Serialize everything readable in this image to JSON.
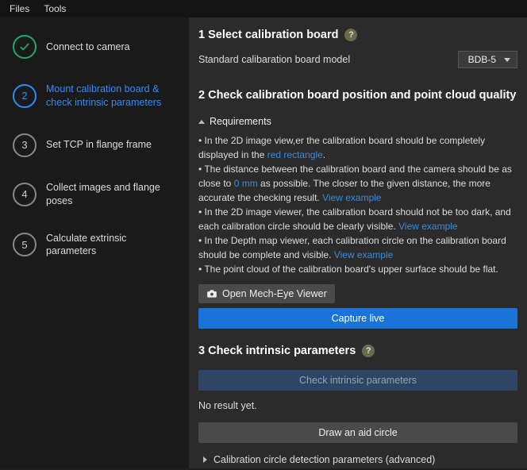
{
  "menu": {
    "files": "Files",
    "tools": "Tools"
  },
  "steps": {
    "s1": "Connect to camera",
    "s2": "Mount calibration board & check intrinsic parameters",
    "s3": "Set TCP in flange frame",
    "s4": "Collect images and flange poses",
    "s5": "Calculate extrinsic parameters",
    "n2": "2",
    "n3": "3",
    "n4": "4",
    "n5": "5"
  },
  "sec1": {
    "title": "1 Select calibration board",
    "label": "Standard calibaration board model",
    "selected": "BDB-5"
  },
  "sec2": {
    "title": "2 Check calibration board position and point cloud quality",
    "req_head": "Requirements",
    "r1a": "• In the 2D image view,er the calibration board should be completely displayed in the ",
    "r1b": "red rectangle",
    "r1c": ".",
    "r2a": "• The distance between the calibration board and the camera should be as close to ",
    "r2b": "0 mm",
    "r2c": " as possible. The closer to the given distance, the more accurate the checking result. ",
    "r2d": "View example",
    "r3a": "• In the 2D image viewer, the calibration board should not be too dark, and each calibration circle should be clearly visible. ",
    "r3b": "View example",
    "r4a": "• In the Depth map viewer, each calibration circle on the calibration board should be complete and visible. ",
    "r4b": "View example",
    "r5": "• The point cloud of the calibration board's upper surface should be flat.",
    "open_viewer": "Open Mech-Eye Viewer",
    "capture": "Capture live"
  },
  "sec3": {
    "title": "3 Check intrinsic parameters",
    "check_btn": "Check intrinsic parameters",
    "result": "No result yet.",
    "draw_btn": "Draw an aid circle",
    "advanced": "Calibration circle detection parameters (advanced)"
  },
  "glyph": {
    "help": "?"
  }
}
